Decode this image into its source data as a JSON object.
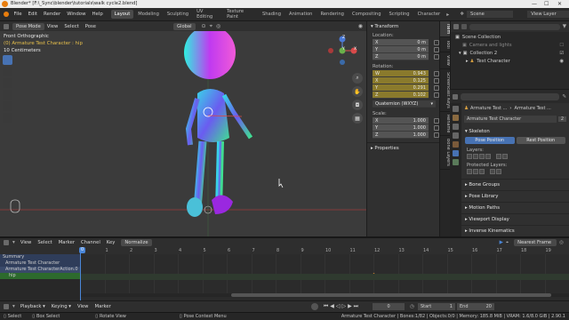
{
  "window": {
    "title": "Blender* [F:\\_Sync\\blender\\tutorials\\walk cycle2.blend]",
    "controls": [
      "—",
      "☐",
      "✕"
    ]
  },
  "menubar": {
    "menus": [
      "File",
      "Edit",
      "Render",
      "Window",
      "Help"
    ],
    "workspaces": [
      "Layout",
      "Modeling",
      "Sculpting",
      "UV Editing",
      "Texture Paint",
      "Shading",
      "Animation",
      "Rendering",
      "Compositing",
      "Scripting",
      "Character"
    ],
    "active_workspace": "Layout",
    "scene_label": "Scene",
    "view_layer_label": "View Layer"
  },
  "viewport": {
    "mode": "Pose Mode",
    "menus": [
      "View",
      "Select",
      "Pose"
    ],
    "transform_orientation": "Global",
    "overlay_line1": "Front Orthographic",
    "overlay_line2": "(0) Armature Test Character : hip",
    "overlay_line3": "10 Centimeters",
    "gizmo_axes": [
      "Z",
      "Y",
      "X"
    ]
  },
  "npanel": {
    "section": "Transform",
    "location_label": "Location:",
    "location": [
      {
        "axis": "X",
        "value": "0 m"
      },
      {
        "axis": "Y",
        "value": "0 m"
      },
      {
        "axis": "Z",
        "value": "0 m"
      }
    ],
    "rotation_label": "Rotation:",
    "rotation": [
      {
        "axis": "W",
        "value": "0.943"
      },
      {
        "axis": "X",
        "value": "0.125"
      },
      {
        "axis": "Y",
        "value": "0.291"
      },
      {
        "axis": "Z",
        "value": "0.102"
      }
    ],
    "rotation_mode": "Quaternion (WXYZ)",
    "scale_label": "Scale:",
    "scale": [
      {
        "axis": "X",
        "value": "1.000"
      },
      {
        "axis": "Y",
        "value": "1.000"
      },
      {
        "axis": "Z",
        "value": "1.000"
      }
    ],
    "properties_section": "Properties",
    "tabs": [
      "Item",
      "Tool",
      "View",
      "Screencast Keys",
      "Rename",
      "Bone Layers"
    ]
  },
  "outliner": {
    "rows": [
      {
        "label": "Scene Collection",
        "indent": 0,
        "color": "#cfcfcf"
      },
      {
        "label": "Camera and lights",
        "indent": 1,
        "color": "#8c8c8c"
      },
      {
        "label": "Collection 2",
        "indent": 1,
        "color": "#cfcfcf"
      },
      {
        "label": "Test Character",
        "indent": 2,
        "color": "#cfcfcf"
      }
    ]
  },
  "properties": {
    "object_name": "Armature Test ...",
    "data_name": "Armature Test ...",
    "datablock_name": "Armature Test Character",
    "users": "2",
    "skeleton_label": "Skeleton",
    "pose_position": "Pose Position",
    "rest_position": "Rest Position",
    "layers_label": "Layers:",
    "protected_layers_label": "Protected Layers:",
    "panels": [
      "Bone Groups",
      "Pose Library",
      "Motion Paths",
      "Viewport Display",
      "Inverse Kinematics"
    ]
  },
  "timeline": {
    "menus": [
      "View",
      "Select",
      "Marker",
      "Channel",
      "Key"
    ],
    "normalize": "Normalize",
    "interpolation": "Nearest Frame",
    "channels": [
      {
        "label": "Summary",
        "color": "#2f3d5a"
      },
      {
        "label": "Armature Test Character",
        "color": "#2f3d5a"
      },
      {
        "label": "Armature Test CharacterAction.0",
        "color": "#3a4a6a"
      },
      {
        "label": "hip",
        "color": "#2d6a2d"
      }
    ],
    "frame_ticks": [
      "0",
      "1",
      "2",
      "3",
      "4",
      "5",
      "6",
      "7",
      "8",
      "9",
      "10",
      "11",
      "12",
      "13",
      "14",
      "15",
      "16",
      "17",
      "18",
      "19"
    ],
    "current_frame": "0",
    "keyframe_frame": 12,
    "start_label": "Start",
    "start_value": "1",
    "end_label": "End",
    "end_value": "20",
    "playback": "Playback",
    "keying": "Keying",
    "view": "View",
    "marker": "Marker"
  },
  "statusbar": {
    "select": "Select",
    "box_select": "Box Select",
    "rotate_view": "Rotate View",
    "context_menu": "Pose Context Menu",
    "stats": "Armature Test Character | Bones:1/82 | Objects:0/0 | Memory: 185.8 MiB | VRAM: 1.6/8.0 GiB | 2.90.1"
  },
  "colors": {
    "accent_blue": "#4772b3",
    "keyframe_orange": "#e8902a",
    "playhead": "#4a86d8",
    "field_yellow": "#8a7a2c"
  }
}
